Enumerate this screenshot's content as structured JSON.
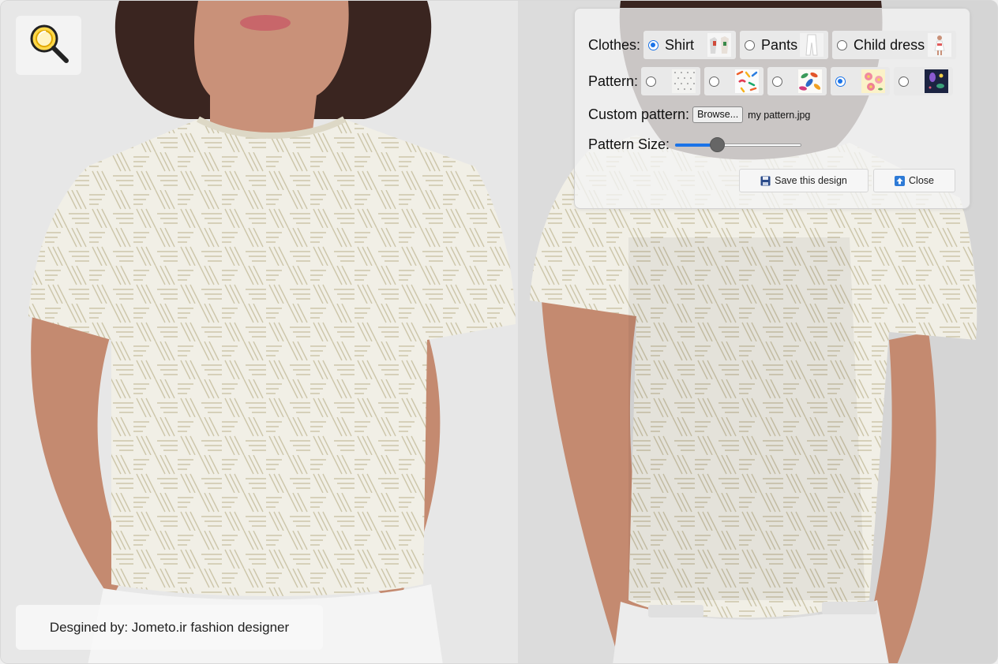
{
  "zoom": {
    "icon": "magnifier-icon"
  },
  "credit": {
    "text": "Desgined by: Jometo.ir fashion designer"
  },
  "panel": {
    "clothes": {
      "label": "Clothes:",
      "options": [
        {
          "label": "Shirt",
          "selected": true,
          "icon": "shirt-thumbnail"
        },
        {
          "label": "Pants",
          "selected": false,
          "icon": "pants-thumbnail"
        },
        {
          "label": "Child dress",
          "selected": false,
          "icon": "child-dress-thumbnail"
        }
      ]
    },
    "pattern": {
      "label": "Pattern:",
      "options": [
        {
          "name": "dots",
          "selected": false
        },
        {
          "name": "confetti",
          "selected": false
        },
        {
          "name": "leaves",
          "selected": false
        },
        {
          "name": "floral",
          "selected": true
        },
        {
          "name": "night",
          "selected": false
        }
      ]
    },
    "custom": {
      "label": "Custom pattern:",
      "browse": "Browse...",
      "file": "my pattern.jpg"
    },
    "size": {
      "label": "Pattern Size:",
      "value": 0.33
    },
    "save_label": "Save this design",
    "close_label": "Close"
  },
  "colors": {
    "accent": "#1a73e8",
    "shirt": "#f1efe6",
    "pattern_line": "#c9c1a4",
    "skin": "#c78d74",
    "hair": "#3a2520"
  }
}
